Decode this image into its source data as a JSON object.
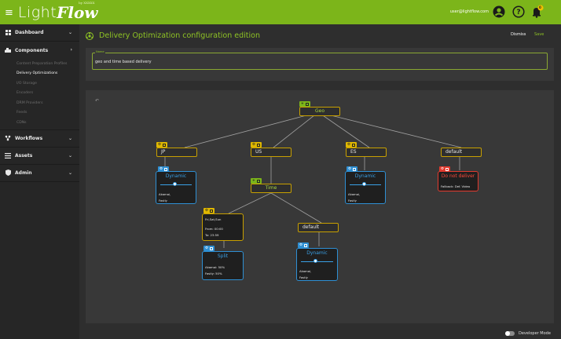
{
  "app": {
    "logo_light": "Light",
    "logo_flow": "Flow",
    "logo_tagline": "by XXXXX",
    "user_email": "user@lightflow.com",
    "notification_count": "0",
    "accent": "#7cb51a"
  },
  "sidebar": {
    "groups": [
      {
        "label": "Dashboard",
        "icon": "dashboard-icon"
      },
      {
        "label": "Components",
        "icon": "components-icon",
        "subitems": [
          "Content Preparation Profiles",
          "Delivery Optimizations",
          "I/O Storage",
          "Encoders",
          "DRM Providers",
          "Feeds",
          "CDNs"
        ],
        "active_index": 1
      },
      {
        "label": "Workflows",
        "icon": "workflows-icon"
      },
      {
        "label": "Assets",
        "icon": "assets-icon"
      },
      {
        "label": "Admin",
        "icon": "admin-icon"
      }
    ]
  },
  "header": {
    "title": "Delivery Optimization configuration edition",
    "dismiss": "Dismiss",
    "save": "Save"
  },
  "form": {
    "name_label": "Name",
    "name_value": "geo and time based delivery"
  },
  "tree": {
    "geo": "Geo",
    "jp": "JP",
    "us": "US",
    "es": "ES",
    "default_top": "default",
    "time": "Time",
    "default_mid": "default",
    "dynamic_jp": {
      "title": "Dynamic",
      "l1": "Akamai,",
      "l2": "Fastly"
    },
    "dynamic_es": {
      "title": "Dynamic",
      "l1": "Akamai,",
      "l2": "Fastly"
    },
    "dynamic_default": {
      "title": "Dynamic",
      "l1": "Akamai,",
      "l2": "Fastly"
    },
    "do_not_deliver": {
      "title": "Do not deliver",
      "l1": "Fallback: Def. Video"
    },
    "schedule": {
      "l1": "Fri,Sat,Sun",
      "l2": "From: 00:00",
      "l3": "To: 23:59"
    },
    "split": {
      "title": "Split",
      "l1": "Akamai: 50%",
      "l2": "Fastly: 50%"
    }
  },
  "footer": {
    "developer_mode": "Developer Mode"
  }
}
